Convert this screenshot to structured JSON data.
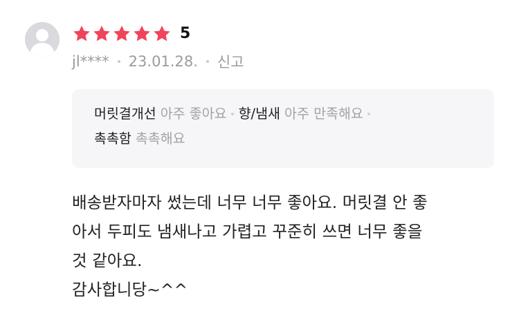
{
  "review": {
    "rating": {
      "stars_filled": 5,
      "stars_total": 5,
      "score_text": "5",
      "star_color": "#f0445b"
    },
    "author": "jl****",
    "date": "23.01.28.",
    "report_label": "신고",
    "attributes": [
      {
        "label": "머릿결개선",
        "value": "아주 좋아요"
      },
      {
        "label": "향/냄새",
        "value": "아주 만족해요"
      },
      {
        "label": "촉촉함",
        "value": "촉촉해요"
      }
    ],
    "body_lines": [
      "배송받자마자 썼는데 너무 너무 좋아요. 머릿결 안 좋",
      "아서 두피도 냄새나고 가렵고 꾸준히 쓰면 너무 좋을",
      "것 같아요.",
      "감사합니당~^^"
    ]
  }
}
